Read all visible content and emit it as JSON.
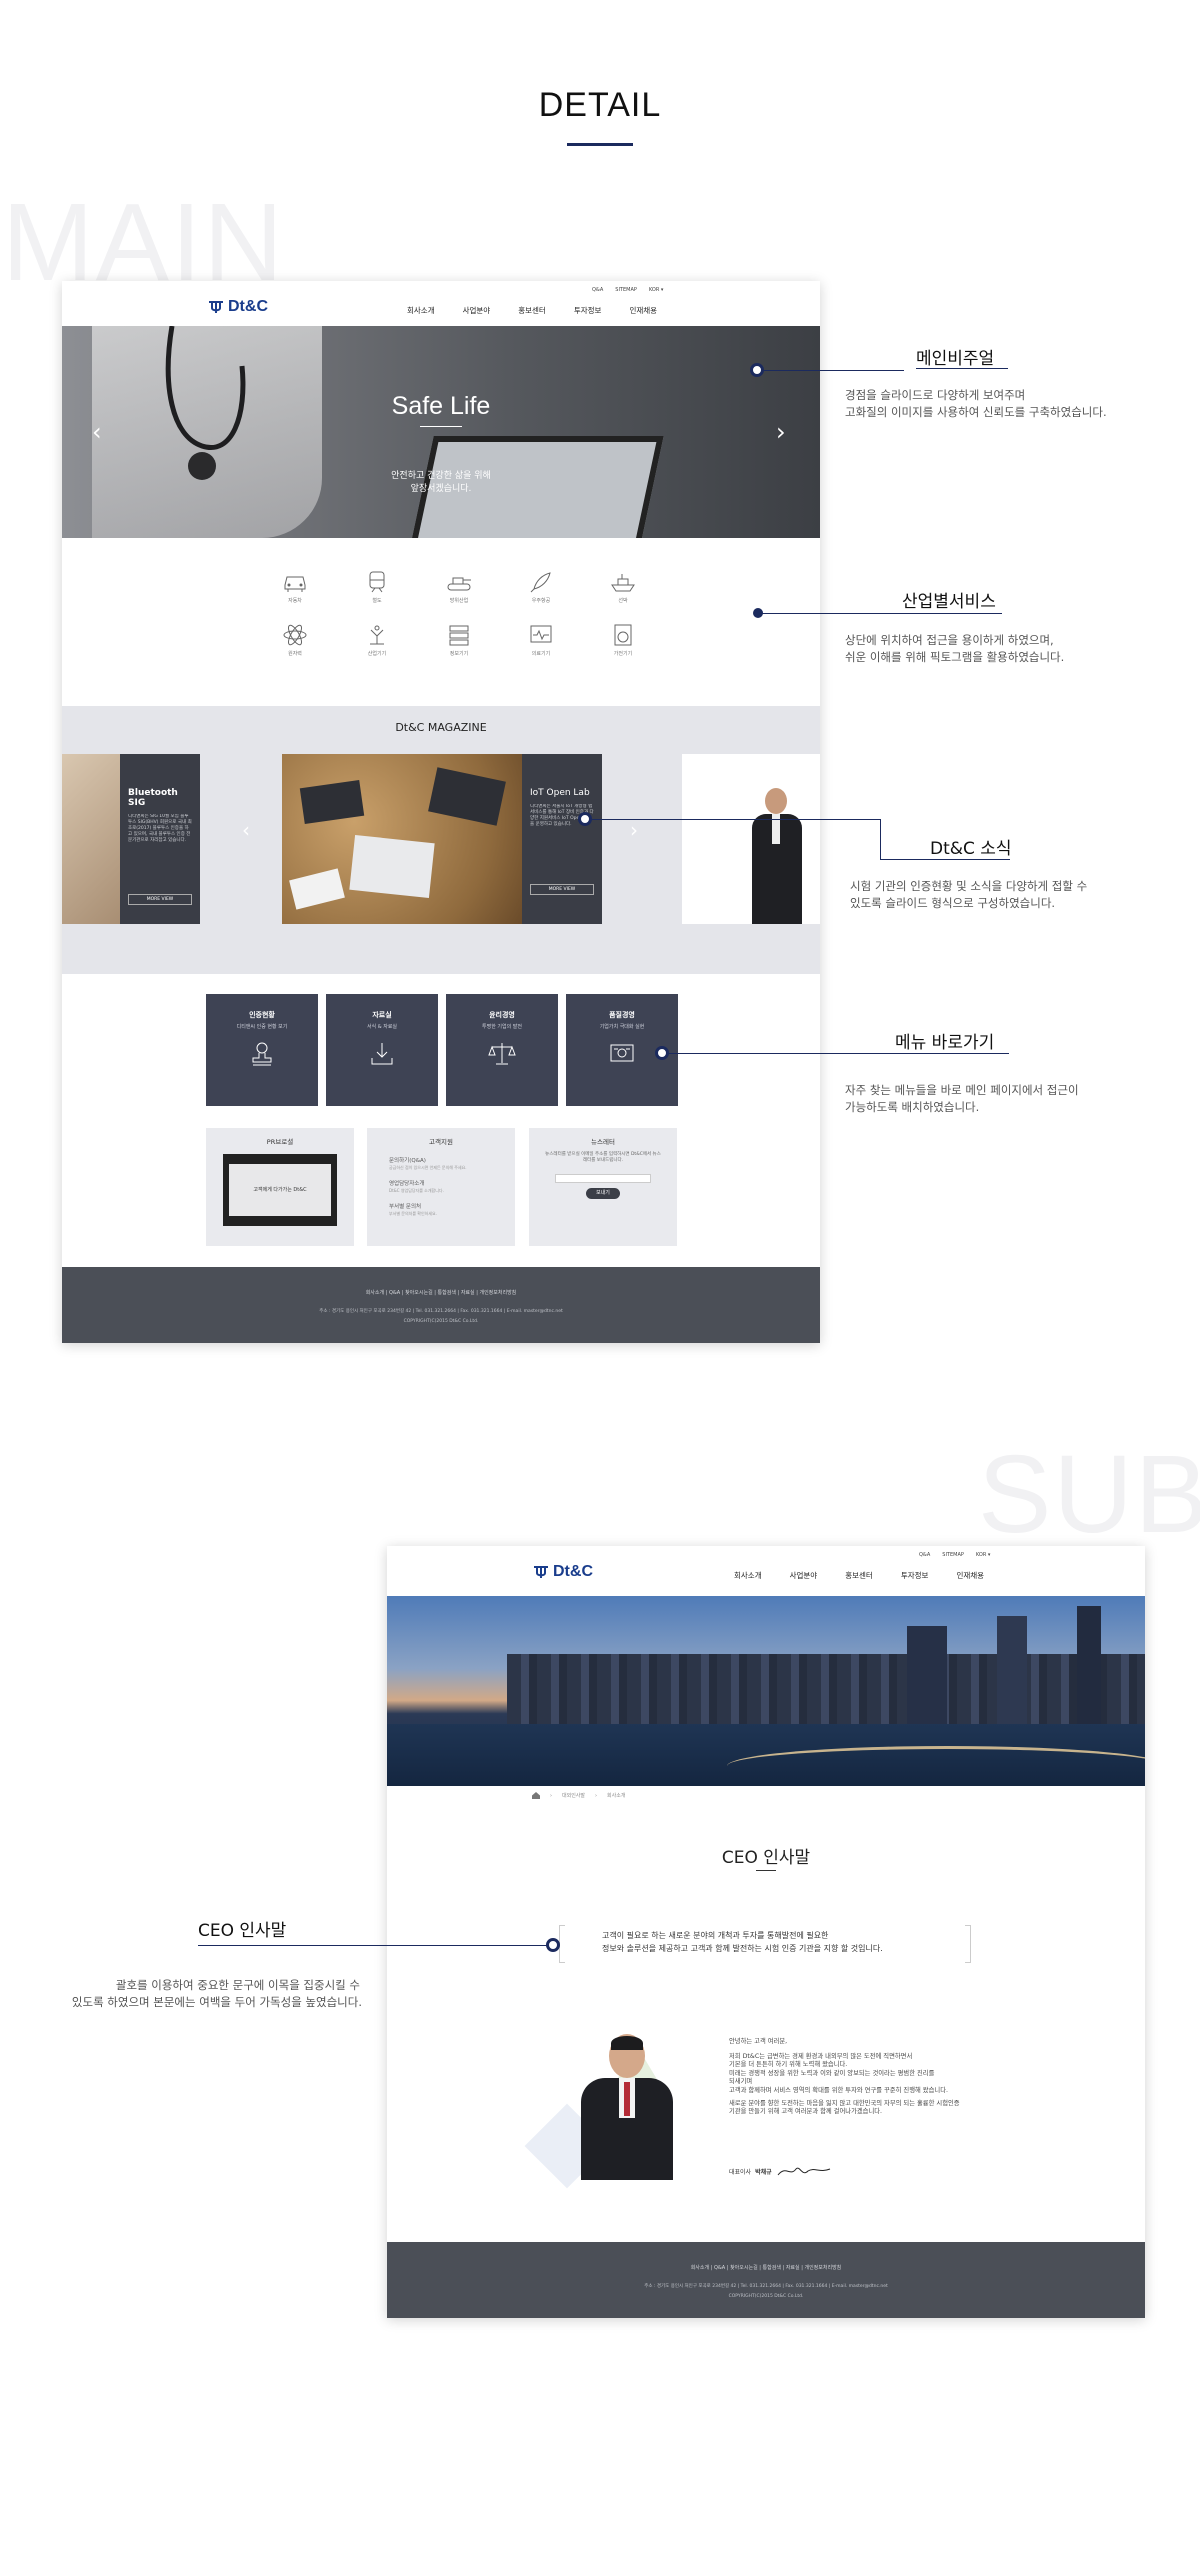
{
  "page_title": "DETAIL",
  "bg_main": "MAIN",
  "bg_sub": "SUB",
  "brand": {
    "logo": "Dt&C",
    "logo_color": "#1a3d8c",
    "accent": "#1b2a5e"
  },
  "util_links": [
    "Q&A",
    "SITEMAP",
    "KOR ▾"
  ],
  "nav": [
    "회사소개",
    "사업분야",
    "홍보센터",
    "투자정보",
    "인재채용"
  ],
  "hero": {
    "title": "Safe Life",
    "subtitle_1": "안전하고 건강한 삶을 위해",
    "subtitle_2": "앞장서겠습니다.",
    "prev": "‹",
    "next": "›"
  },
  "industry_icons": [
    {
      "icon": "car-icon",
      "label": "자동차"
    },
    {
      "icon": "train-icon",
      "label": "철도"
    },
    {
      "icon": "tank-icon",
      "label": "방위산업"
    },
    {
      "icon": "rocket-icon",
      "label": "우주항공"
    },
    {
      "icon": "ship-icon",
      "label": "선박"
    },
    {
      "icon": "atom-icon",
      "label": "원자력"
    },
    {
      "icon": "robot-icon",
      "label": "산업기기"
    },
    {
      "icon": "server-icon",
      "label": "정보기기"
    },
    {
      "icon": "monitor-icon",
      "label": "의료기기"
    },
    {
      "icon": "washer-icon",
      "label": "가전기기"
    }
  ],
  "magazine": {
    "heading": "Dt&C MAGAZINE",
    "card_left_title": "Bluetooth SIG",
    "card_left_text": "디티앤씨는 SIG 10월 모임 블루투스 SIG(BHV) 회원으로 국내 최초로(2017) 블루투스 인증을 하고 있으며, 국내 블루투스 인증 전문기관으로 자리잡고 있습니다.",
    "card_left_btn": "MORE VIEW",
    "card_mid_title": "IoT Open Lab",
    "card_mid_text": "디티앤씨는 서울시 IoT 개방형 랩 서비스를 통해 IoT 장비 인증과 다양한 지원서비스 IoT Open Lab을 운영하고 있습니다.",
    "card_mid_btn": "MORE VIEW",
    "prev": "‹",
    "next": "›"
  },
  "quick_menu": [
    {
      "title": "인증현황",
      "sub": "디티앤씨 인증 현황 보기",
      "icon": "stamp-icon"
    },
    {
      "title": "자료실",
      "sub": "서식 & 자료실",
      "icon": "download-icon"
    },
    {
      "title": "윤리경영",
      "sub": "투명한 기업의 발전",
      "icon": "scale-icon"
    },
    {
      "title": "품질경영",
      "sub": "기업가치 극대화 실현",
      "icon": "certificate-icon"
    }
  ],
  "info_boxes": {
    "pr_title": "PR브로셜",
    "pr_video_text": "고객에게 다가가는 Dt&C",
    "cs_title": "고객지원",
    "cs_items": [
      {
        "t": "문의하기(Q&A)",
        "d": "궁금하신 점이 있으시면 언제든 문의해 주세요."
      },
      {
        "t": "영업담당자소개",
        "d": "Dt&C 영업담당자를 소개합니다."
      },
      {
        "t": "부서별 문의처",
        "d": "부서별 문의처를 확인하세요."
      }
    ],
    "nl_title": "뉴스레터",
    "nl_text": "뉴스레터를 받으실 이메일 주소를 입력하시면 Dt&C에서 뉴스레터를 보내드립니다.",
    "nl_btn": "보내기"
  },
  "footer": {
    "links": "회사소개  |  Q&A  |  찾아오시는길  |  통합검색  |  자료실  |  개인정보처리방침",
    "address": "주소 : 경기도 용인시 처인구 포곡로 234번길 42  |  Tel. 031.321.2664  |  Fax. 031.321.1664  |  E-mail. master@dtnc.net",
    "copyright": "COPYRIGHT(C)2015 Dt&C Co.Ltd."
  },
  "callouts_main": [
    {
      "title": "메인비주얼",
      "desc_1": "경점을 슬라이드로 다양하게 보여주며",
      "desc_2": "고화질의 이미지를 사용하여 신뢰도를 구축하였습니다."
    },
    {
      "title": "산업별서비스",
      "desc_1": "상단에 위치하여 접근을 용이하게 하였으며,",
      "desc_2": "쉬운 이해를 위해 픽토그램을 활용하였습니다."
    },
    {
      "title": "Dt&C 소식",
      "desc_1": "시험 기관의 인증현황 및 소식을 다양하게 접할 수",
      "desc_2": "있도록 슬라이드 형식으로 구성하였습니다."
    },
    {
      "title": "메뉴 바로가기",
      "desc_1": "자주 찾는 메뉴들을 바로 메인 페이지에서 접근이",
      "desc_2": "가능하도록 배치하였습니다."
    }
  ],
  "sub": {
    "breadcrumb": [
      "대외인사말",
      "회사소개"
    ],
    "heading": "CEO 인사말",
    "quote_1": "고객이 필요로 하는 새로운 분야의 개척과 투자를 통해발전에 필요한",
    "quote_2": "정보와 솔루션을 제공하고 고객과 함께 발전하는 시험 인증 기관을 지향 할 것입니다.",
    "greeting": [
      "안녕하는 고객 여러분,",
      "저희 Dt&C는 급변하는 경제 환경과 내외부의 많은 도전에 직면하면서",
      "기본을 더 튼튼히 하기 위해 노력해 왔습니다.",
      "미래는 경쟁적 성장을 위한 노력과 이와 같이 양보되는 것이라는 평범한 진리를",
      "되새기며",
      "고객과 함께하며 서비스 영역의 확대를 위한 투자와 연구를 꾸준히 진행해 왔습니다.",
      "",
      "새로운 분야를 향한 도전하는 마음을 잃지 않고 대한민국의 자부의 되는 훌륭한 시험인증",
      "기관을 만들기 위해 고객 여러분과 함께 걸어나가겠습니다."
    ],
    "sign_label": "대표이사",
    "sign_name": "박채규",
    "callout_title": "CEO 인사말",
    "callout_desc_1": "괄호를 이용하여 중요한 문구에 이목을 집중시킬 수",
    "callout_desc_2": "있도록 하였으며  본문에는 여백을 두어 가독성을 높였습니다."
  }
}
